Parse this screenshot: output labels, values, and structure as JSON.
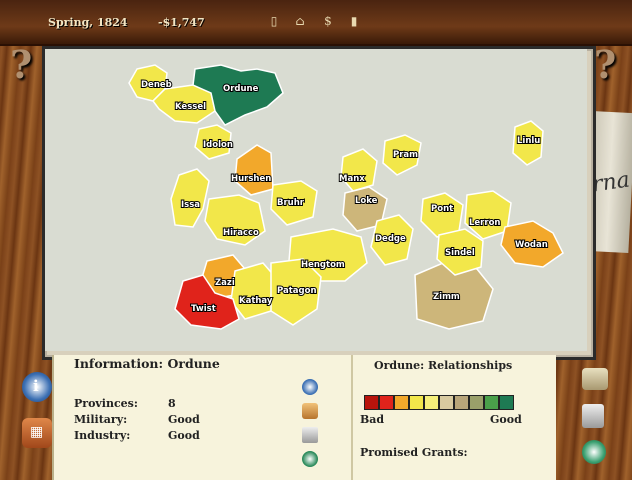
{
  "topbar": {
    "season": "Spring, 1824",
    "money": "-$1,747"
  },
  "corners": {
    "left": "?",
    "right": "?"
  },
  "newspaper_label": "rna",
  "map": {
    "provinces": [
      {
        "name": "Deneb",
        "color": "#f2e74a"
      },
      {
        "name": "Kessel",
        "color": "#f2e74a"
      },
      {
        "name": "Ordune",
        "color": "#1e7a53"
      },
      {
        "name": "Idolon",
        "color": "#f2e74a"
      },
      {
        "name": "Hurshen",
        "color": "#f2a82b"
      },
      {
        "name": "Issa",
        "color": "#f2e74a"
      },
      {
        "name": "Bruhr",
        "color": "#f2e74a"
      },
      {
        "name": "Hiracco",
        "color": "#f2e74a"
      },
      {
        "name": "Hengtom",
        "color": "#f2e74a"
      },
      {
        "name": "Zazi",
        "color": "#f2a82b"
      },
      {
        "name": "Kathay",
        "color": "#f2e74a"
      },
      {
        "name": "Patagon",
        "color": "#f2e74a"
      },
      {
        "name": "Twist",
        "color": "#e0231b"
      },
      {
        "name": "Manx",
        "color": "#f2e74a"
      },
      {
        "name": "Pram",
        "color": "#f2e74a"
      },
      {
        "name": "Loke",
        "color": "#cdb67a"
      },
      {
        "name": "Dedge",
        "color": "#f2e74a"
      },
      {
        "name": "Zimm",
        "color": "#cdb67a"
      },
      {
        "name": "Pont",
        "color": "#f2e74a"
      },
      {
        "name": "Lerron",
        "color": "#f2e74a"
      },
      {
        "name": "Sindel",
        "color": "#f2e74a"
      },
      {
        "name": "Wodan",
        "color": "#f2a82b"
      },
      {
        "name": "Linlu",
        "color": "#f2e74a"
      }
    ]
  },
  "info": {
    "title": "Information:  Ordune",
    "provinces_label": "Provinces:",
    "provinces_value": "8",
    "military_label": "Military:",
    "military_value": "Good",
    "industry_label": "Industry:",
    "industry_value": "Good"
  },
  "relations": {
    "title": "Ordune: Relationships",
    "bad_label": "Bad",
    "good_label": "Good",
    "promised_label": "Promised Grants:",
    "scale_colors": [
      "#b8140c",
      "#e0231b",
      "#f2a82b",
      "#f2e74a",
      "#f6f07a",
      "#d8caa0",
      "#b8a57a",
      "#9aa06a",
      "#4aa04a",
      "#1e7a53"
    ]
  }
}
